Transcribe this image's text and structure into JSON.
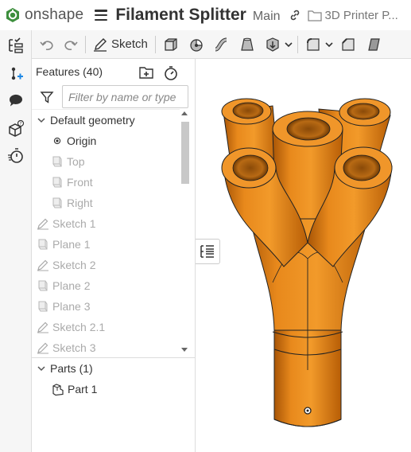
{
  "app": {
    "logo_text": "onshape"
  },
  "document": {
    "title": "Filament Splitter",
    "branch": "Main",
    "folder": "3D Printer P..."
  },
  "toolbar": {
    "sketch_label": "Sketch"
  },
  "panel": {
    "title": "Features (40)",
    "filter_placeholder": "Filter by name or type",
    "default_geometry_label": "Default geometry",
    "items": [
      {
        "label": "Origin",
        "icon": "origin-icon",
        "dim": false
      },
      {
        "label": "Top",
        "icon": "plane-icon",
        "dim": true
      },
      {
        "label": "Front",
        "icon": "plane-icon",
        "dim": true
      },
      {
        "label": "Right",
        "icon": "plane-icon",
        "dim": true
      },
      {
        "label": "Sketch 1",
        "icon": "sketch-icon",
        "dim": true
      },
      {
        "label": "Plane 1",
        "icon": "plane-icon",
        "dim": true
      },
      {
        "label": "Sketch 2",
        "icon": "sketch-icon",
        "dim": true
      },
      {
        "label": "Plane 2",
        "icon": "plane-icon",
        "dim": true
      },
      {
        "label": "Plane 3",
        "icon": "plane-icon",
        "dim": true
      },
      {
        "label": "Sketch 2.1",
        "icon": "sketch-icon",
        "dim": true
      },
      {
        "label": "Sketch 3",
        "icon": "sketch-icon",
        "dim": true
      }
    ],
    "parts_label": "Parts (1)",
    "parts": [
      {
        "label": "Part 1",
        "icon": "part-icon"
      }
    ]
  },
  "colors": {
    "model": "#e07f10",
    "model_dark": "#b85e06",
    "accent": "#2e7d32"
  }
}
